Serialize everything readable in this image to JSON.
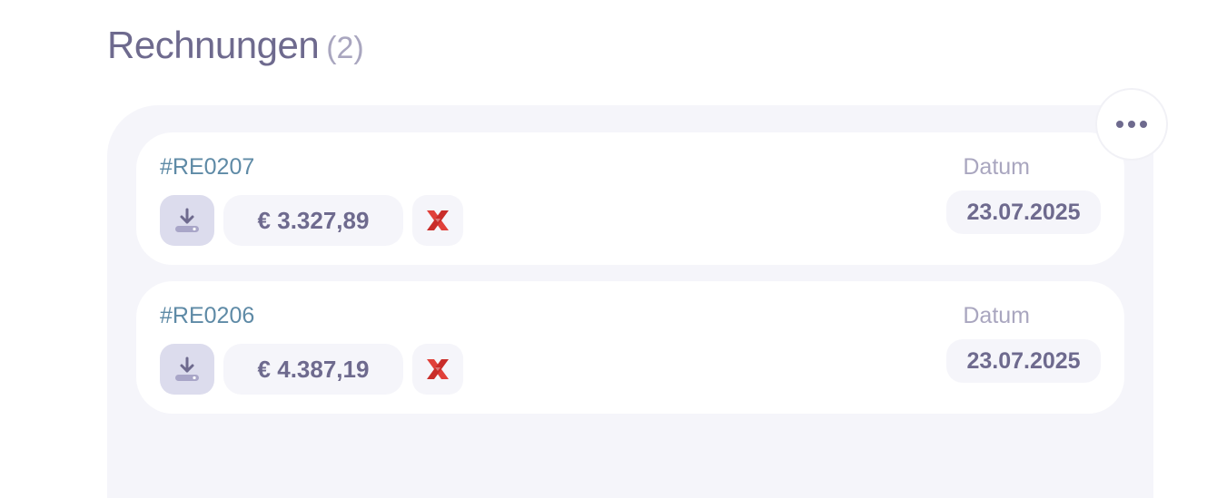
{
  "section": {
    "title": "Rechnungen",
    "count": "(2)"
  },
  "invoices": [
    {
      "id": "#RE0207",
      "amount": "€ 3.327,89",
      "date_label": "Datum",
      "date": "23.07.2025"
    },
    {
      "id": "#RE0206",
      "amount": "€ 4.387,19",
      "date_label": "Datum",
      "date": "23.07.2025"
    }
  ],
  "icons": {
    "more": "more-horizontal-icon",
    "download": "download-icon",
    "xrechnung": "x-logo-icon"
  },
  "colors": {
    "title": "#6e6a8e",
    "id": "#5e8aa6",
    "panel": "#f5f5fa",
    "download_bg": "#dcdced",
    "x_red": "#e0403a"
  }
}
